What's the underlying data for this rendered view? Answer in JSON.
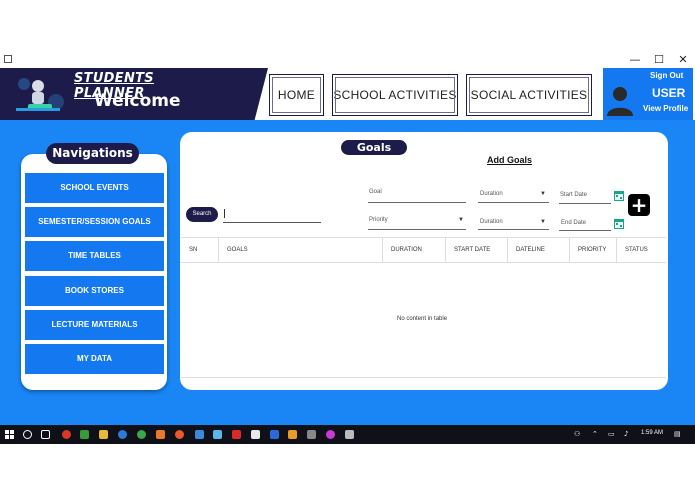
{
  "window": {
    "minimize": "—",
    "maximize": "☐",
    "close": "✕"
  },
  "header": {
    "app_title": "STUDENTS PLANNER",
    "welcome": "Welcome",
    "nav": [
      "HOME",
      "SCHOOL ACTIVITIES",
      "SOCIAL ACTIVITIES"
    ],
    "sign_out": "Sign Out",
    "username": "USER",
    "view_profile": "View Profile"
  },
  "sidebar": {
    "title": "Navigations",
    "items": [
      {
        "label": "SCHOOL EVENTS"
      },
      {
        "label": "SEMESTER/SESSION GOALS"
      },
      {
        "label": "TIME TABLES"
      },
      {
        "label": "BOOK STORES"
      },
      {
        "label": "LECTURE MATERIALS"
      },
      {
        "label": "MY DATA"
      }
    ]
  },
  "goals": {
    "title": "Goals",
    "add_goals": "Add Goals",
    "search_label": "Search",
    "form": {
      "goal_placeholder": "Goal",
      "duration1_placeholder": "Duration",
      "start_date_placeholder": "Start Date",
      "priority_placeholder": "Priority",
      "duration2_placeholder": "Duration",
      "end_date_placeholder": "End Date",
      "add_symbol": "+"
    },
    "table": {
      "columns": [
        "SN",
        "GOALS",
        "DURATION",
        "START DATE",
        "DATELINE",
        "PRIORITY",
        "STATUS"
      ],
      "empty_text": "No content in table"
    }
  },
  "taskbar": {
    "time": "1:59 AM",
    "colors": {
      "accent": "#1a86f5",
      "navy": "#1c1b4a"
    }
  }
}
